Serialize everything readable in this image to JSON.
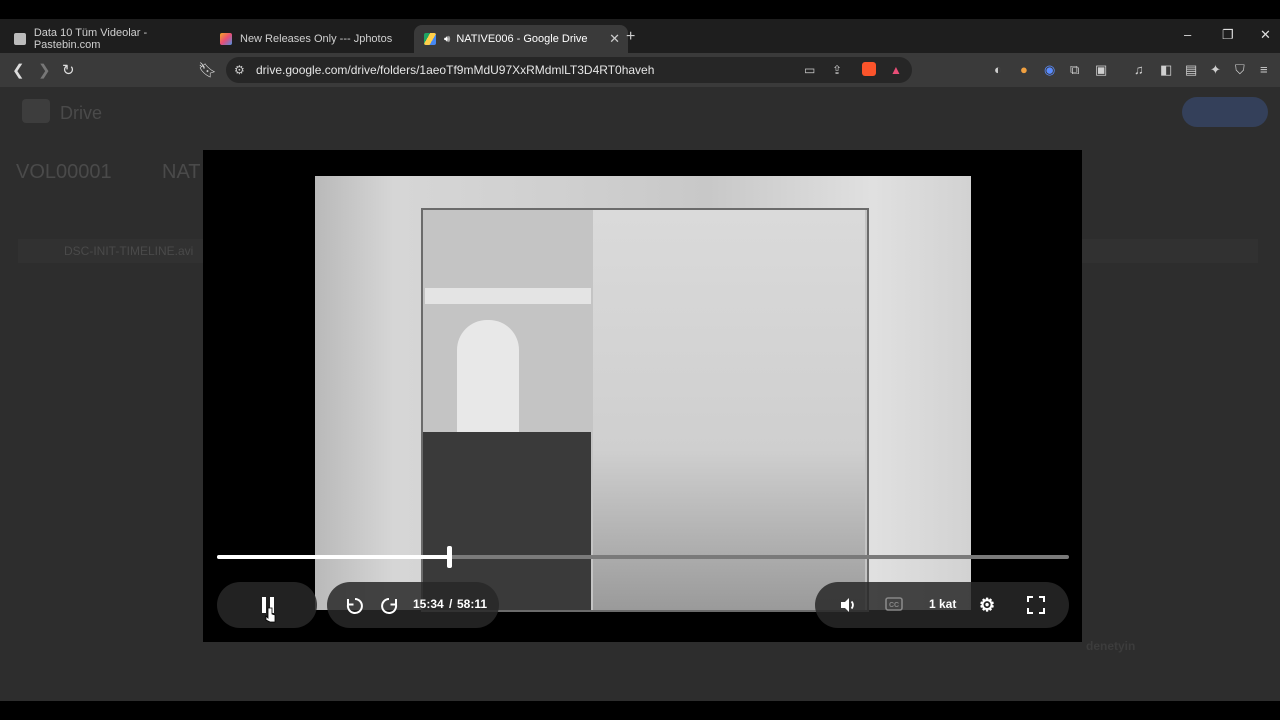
{
  "tabs": [
    {
      "label": "Data 10 Tüm Videolar - Pastebin.com"
    },
    {
      "label": "New Releases Only --- Jphotos"
    },
    {
      "label": "NATIVE006 - Google Drive"
    }
  ],
  "window": {
    "new_tab": "+",
    "minimize": "–",
    "restore": "❐",
    "close": "✕"
  },
  "toolbar": {
    "url": "drive.google.com/drive/folders/1aeoTf9mMdU97XxRMdmlLT3D4RT0haveh"
  },
  "drive": {
    "logo_text": "Drive",
    "breadcrumb": "VOL00001",
    "breadcrumb_next": "NAT",
    "file_name": "DSC-INIT-TIMELINE.avi",
    "toast_title": "denetyin"
  },
  "player": {
    "progress_fraction": 0.272,
    "current_time": "15:34",
    "separator": "/",
    "duration": "58:11",
    "speed_label": "1 kat",
    "rewind_seconds": "10",
    "forward_seconds": "10"
  }
}
